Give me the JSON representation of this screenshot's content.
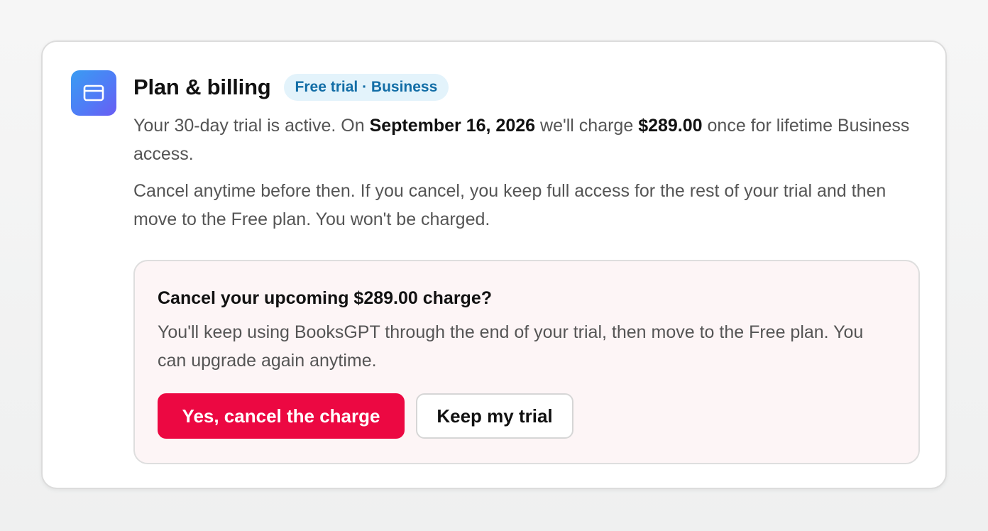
{
  "card": {
    "icon": "credit-card-icon",
    "title": "Plan & billing",
    "badge": "Free trial · Business",
    "paragraph1": {
      "before_date": "Your 30-day trial is active. On ",
      "date": "September 16, 2026",
      "mid": " we'll charge ",
      "amount": "$289.00",
      "after": " once for lifetime Business access."
    },
    "paragraph2": "Cancel anytime before then. If you cancel, you keep full access for the rest of your trial and then move to the Free plan. You won't be charged."
  },
  "cancel_prompt": {
    "title": "Cancel your upcoming $289.00 charge?",
    "description": "You'll keep using BooksGPT through the end of your trial, then move to the Free plan. You can upgrade again anytime.",
    "confirm_label": "Yes, cancel the charge",
    "keep_label": "Keep my trial"
  },
  "colors": {
    "accent_danger": "#ec0842",
    "badge_bg": "#e3f3fb",
    "badge_text": "#126da6",
    "prompt_bg": "#fdf5f6"
  }
}
